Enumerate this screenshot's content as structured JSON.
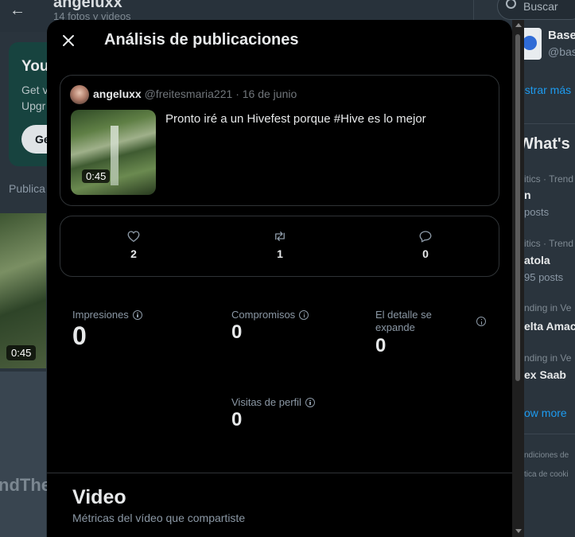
{
  "background": {
    "profile_name": "angeluxx",
    "profile_sub": "14 fotos y videos",
    "premium_title": "You",
    "premium_text_lines": [
      "Get v",
      "Upgr"
    ],
    "premium_button": "Ge",
    "tab_label": "Publica",
    "media_duration": "0:45",
    "bottom_text": "ndThe",
    "search_placeholder": "Buscar",
    "account_name": "Base",
    "account_handle": "@bas",
    "show_more_link": "ostrar más",
    "whats_happening": "What's h",
    "trends": [
      {
        "meta": "itics · Trend",
        "name": "n",
        "posts": "posts"
      },
      {
        "meta": "itics · Trend",
        "name": "atola",
        "posts": "95 posts"
      },
      {
        "meta": "nding in Ve",
        "name": "elta Amac",
        "posts": ""
      },
      {
        "meta": "nding in Ve",
        "name": "ex Saab",
        "posts": ""
      }
    ],
    "show_more": "ow more",
    "footer": [
      "ndiciones de",
      "tica de cooki"
    ]
  },
  "modal": {
    "title": "Análisis de publicaciones",
    "post": {
      "author_name": "angeluxx",
      "author_handle": "@freitesmaria221",
      "date": "16 de junio",
      "separator": "·",
      "text": "Pronto iré a un Hivefest porque #Hive es lo mejor",
      "media_duration": "0:45"
    },
    "engagement": {
      "likes": "2",
      "reposts": "1",
      "replies": "0"
    },
    "metrics": {
      "impressions_label": "Impresiones",
      "impressions_value": "0",
      "engagements_label": "Compromisos",
      "engagements_value": "0",
      "detail_expands_label_1": "El detalle se",
      "detail_expands_label_2": "expande",
      "detail_expands_value": "0",
      "profile_visits_label": "Visitas de perfil",
      "profile_visits_value": "0"
    },
    "video_section": {
      "title": "Video",
      "subtitle": "Métricas del vídeo que compartiste"
    }
  },
  "colors": {
    "modal_bg": "#000000",
    "border": "#2f3336",
    "text_primary": "#e7e9ea",
    "text_secondary": "#71767b",
    "link": "#1d9bf0"
  }
}
